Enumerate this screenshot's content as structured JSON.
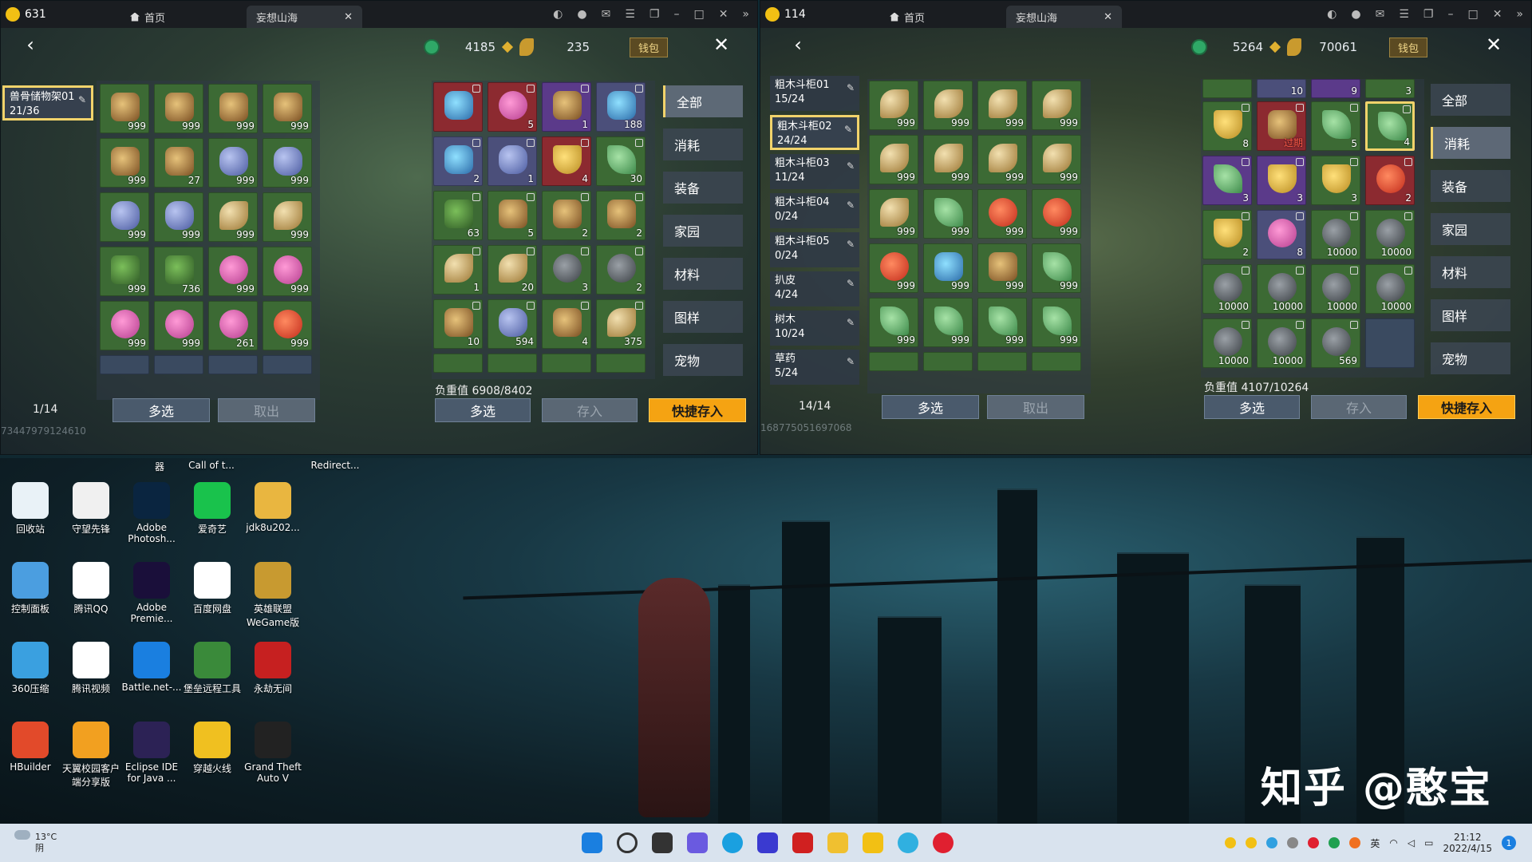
{
  "left_window": {
    "tab_count": "631",
    "home_tab": "首页",
    "game_tab": "妄想山海",
    "coins": "4185",
    "leaves": "235",
    "wallet": "钱包",
    "storage_name": "兽骨储物架01",
    "storage_load": "21/36",
    "page": "1/14",
    "multi": "多选",
    "take": "取出",
    "weight": "负重值 6908/8402",
    "store": "存入",
    "quick_store": "快捷存入",
    "ghost_id": "73447979124610",
    "storage_slots": [
      "999",
      "999",
      "999",
      "999",
      "999",
      "27",
      "999",
      "999",
      "999",
      "999",
      "999",
      "999",
      "999",
      "736",
      "999",
      "999",
      "999",
      "999",
      "261",
      "999"
    ],
    "bag_slots": [
      "",
      "5",
      "1",
      "188",
      "2",
      "1",
      "4",
      "30",
      "63",
      "5",
      "2",
      "2",
      "1",
      "20",
      "3",
      "2",
      "10",
      "594",
      "4",
      "375"
    ],
    "categories": [
      "全部",
      "消耗",
      "装备",
      "家园",
      "材料",
      "图样",
      "宠物"
    ]
  },
  "right_window": {
    "tab_count": "114",
    "home_tab": "首页",
    "game_tab": "妄想山海",
    "coins": "5264",
    "leaves": "70061",
    "wallet": "钱包",
    "cabinets": [
      {
        "name": "粗木斗柜01",
        "load": "15/24"
      },
      {
        "name": "粗木斗柜02",
        "load": "24/24"
      },
      {
        "name": "粗木斗柜03",
        "load": "11/24"
      },
      {
        "name": "粗木斗柜04",
        "load": "0/24"
      },
      {
        "name": "粗木斗柜05",
        "load": "0/24"
      },
      {
        "name": "扒皮",
        "load": "4/24"
      },
      {
        "name": "树木",
        "load": "10/24"
      },
      {
        "name": "草药",
        "load": "5/24"
      }
    ],
    "page": "14/14",
    "multi": "多选",
    "take": "取出",
    "weight": "负重值 4107/10264",
    "store": "存入",
    "quick_store": "快捷存入",
    "ghost_id": "168775051697068",
    "storage_slots": [
      "999",
      "999",
      "999",
      "999",
      "999",
      "999",
      "999",
      "999",
      "999",
      "999",
      "999",
      "999",
      "999",
      "999",
      "999",
      "999",
      "999",
      "999",
      "999",
      "999"
    ],
    "bag_top": [
      "",
      "10",
      "9",
      "3"
    ],
    "bag_slots": [
      "8",
      "过期",
      "5",
      "4",
      "3",
      "3",
      "3",
      "2",
      "2",
      "8",
      "10000",
      "10000",
      "10000",
      "10000",
      "10000",
      "10000",
      "10000",
      "10000",
      "569",
      ""
    ],
    "categories": [
      "全部",
      "消耗",
      "装备",
      "家园",
      "材料",
      "图样",
      "宠物"
    ]
  },
  "desktop": {
    "top_labels": [
      "器",
      "Call of t...",
      "Redirect..."
    ],
    "icons": [
      {
        "label": "回收站",
        "color": "#e9f2f7"
      },
      {
        "label": "守望先锋",
        "color": "#f0f0f0"
      },
      {
        "label": "Adobe Photosh...",
        "color": "#0a2540"
      },
      {
        "label": "爱奇艺",
        "color": "#19c24c"
      },
      {
        "label": "jdk8u202...",
        "color": "#e9b640"
      },
      {
        "label": "控制面板",
        "color": "#4b9ee0"
      },
      {
        "label": "腾讯QQ",
        "color": "#ffffff"
      },
      {
        "label": "Adobe Premie...",
        "color": "#1a0f3a"
      },
      {
        "label": "百度网盘",
        "color": "#ffffff"
      },
      {
        "label": "英雄联盟 WeGame版",
        "color": "#c89a30"
      },
      {
        "label": "360压缩",
        "color": "#3aa0e0"
      },
      {
        "label": "腾讯视频",
        "color": "#ffffff"
      },
      {
        "label": "Battle.net-...",
        "color": "#1a7fe0"
      },
      {
        "label": "堡垒远程工具",
        "color": "#3a8a3a"
      },
      {
        "label": "永劫无间",
        "color": "#c62020"
      },
      {
        "label": "HBuilder",
        "color": "#e24a2a"
      },
      {
        "label": "天翼校园客户端分享版",
        "color": "#f2a020"
      },
      {
        "label": "Eclipse IDE for Java ...",
        "color": "#2c2255"
      },
      {
        "label": "穿越火线",
        "color": "#f0c020"
      },
      {
        "label": "Grand Theft Auto V",
        "color": "#222222"
      }
    ],
    "watermark": "知乎 @憨宝"
  },
  "taskbar": {
    "weather_temp": "13°C",
    "weather_text": "阴",
    "ime": "英",
    "time": "21:12",
    "date": "2022/4/15",
    "badge": "1"
  }
}
